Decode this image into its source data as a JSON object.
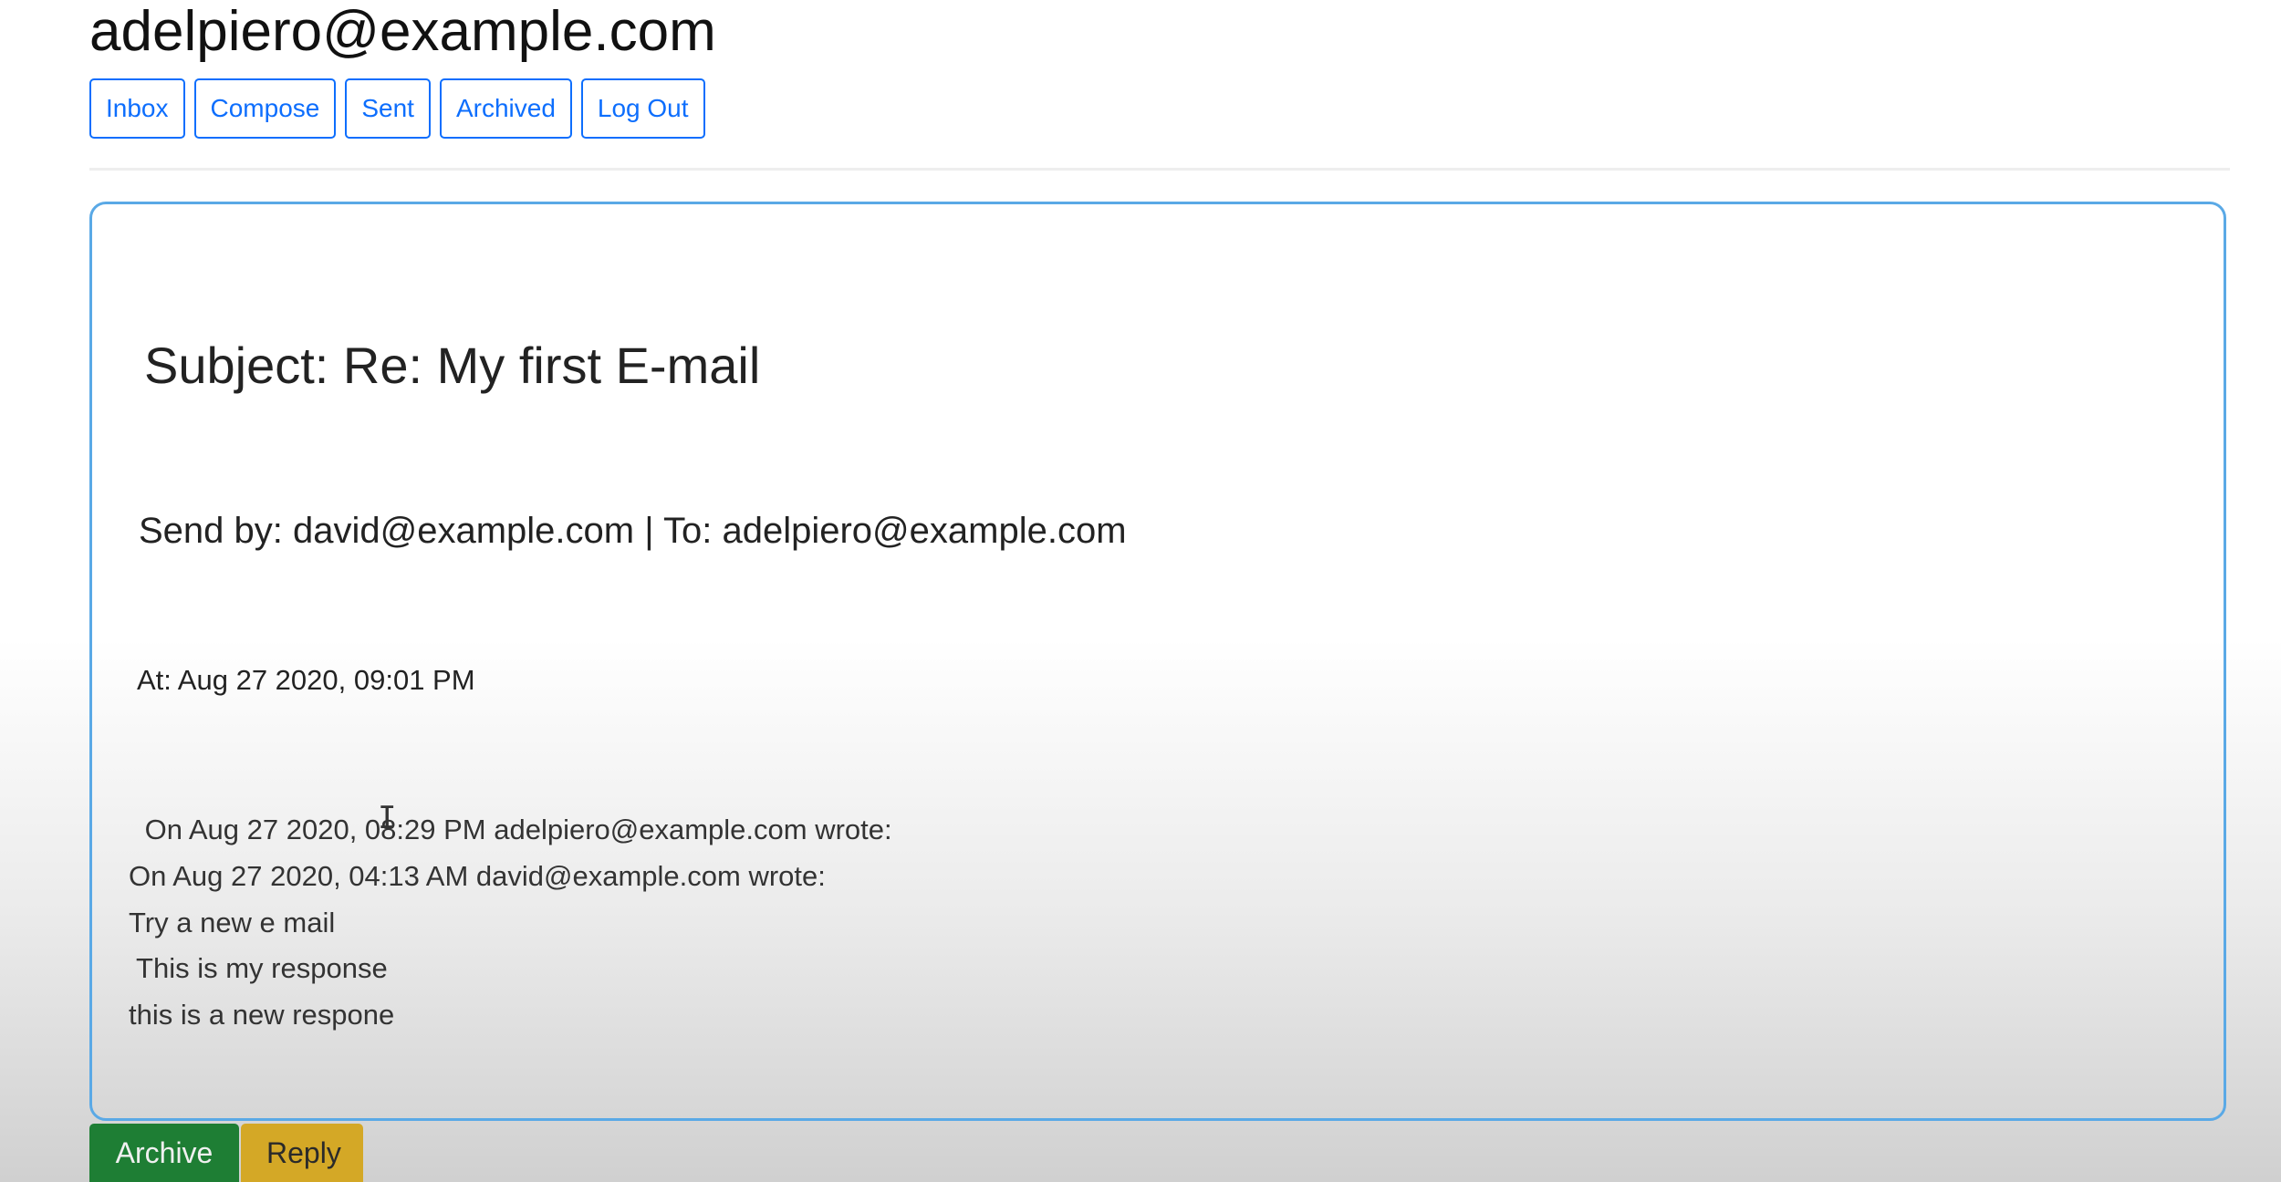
{
  "header": {
    "user_email": "adelpiero@example.com"
  },
  "nav": {
    "inbox_label": "Inbox",
    "compose_label": "Compose",
    "sent_label": "Sent",
    "archived_label": "Archived",
    "logout_label": "Log Out"
  },
  "email": {
    "subject_line": "Subject: Re: My first E-mail",
    "sender_line": "Send by: david@example.com | To: adelpiero@example.com",
    "timestamp_line": "At: Aug 27 2020, 09:01 PM",
    "body_lines": [
      " On Aug 27 2020, 08:29 PM adelpiero@example.com wrote:",
      "On Aug 27 2020, 04:13 AM david@example.com wrote:",
      "Try a new e mail",
      " This is my response",
      "this is a new respone"
    ]
  },
  "actions": {
    "archive_label": "Archive",
    "reply_label": "Reply"
  },
  "colors": {
    "primary": "#0d6efd",
    "card_border": "#5aa9e6",
    "archive_green": "#1e7e34",
    "reply_yellow": "#d4a826"
  },
  "icons": {
    "text_cursor": "i-beam-cursor-icon"
  }
}
